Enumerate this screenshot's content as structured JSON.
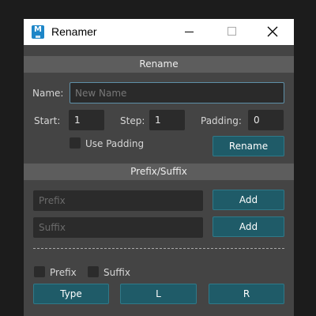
{
  "window": {
    "title": "Renamer",
    "icon_label": "M"
  },
  "rename": {
    "section_title": "Rename",
    "name_label": "Name:",
    "name_placeholder": "New Name",
    "start_label": "Start:",
    "start_value": "1",
    "step_label": "Step:",
    "step_value": "1",
    "padding_label": "Padding:",
    "padding_value": "0",
    "use_padding_label": "Use Padding",
    "rename_button": "Rename"
  },
  "prefix_suffix": {
    "section_title": "Prefix/Suffix",
    "prefix_placeholder": "Prefix",
    "suffix_placeholder": "Suffix",
    "add_prefix_button": "Add",
    "add_suffix_button": "Add",
    "prefix_checkbox_label": "Prefix",
    "suffix_checkbox_label": "Suffix",
    "type_button": "Type",
    "l_button": "L",
    "r_button": "R"
  },
  "colors": {
    "accent_button": "#1f5b68",
    "panel_bg": "#444444",
    "section_bar": "#5d5d5d",
    "focus_border": "#5e8fa8"
  },
  "icons": [
    "app-icon",
    "minimize-icon",
    "maximize-icon",
    "close-icon"
  ]
}
